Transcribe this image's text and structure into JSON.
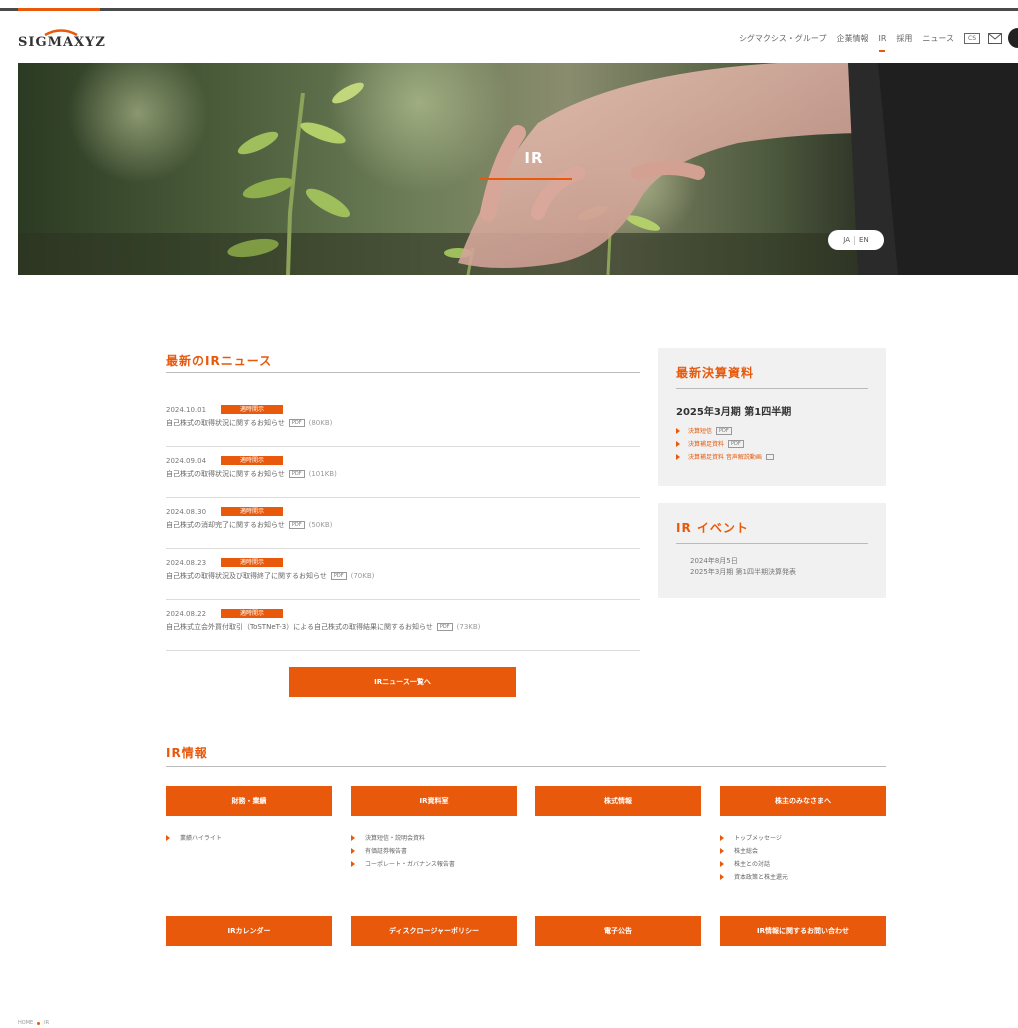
{
  "header": {
    "logo": "SIGMAXYZ",
    "nav": [
      {
        "label": "シグマクシス・グループ"
      },
      {
        "label": "企業情報"
      },
      {
        "label": "IR",
        "active": true
      },
      {
        "label": "採用"
      },
      {
        "label": "ニュース"
      }
    ],
    "box_label": "CS",
    "accent_color": "#e8590c"
  },
  "hero": {
    "title": "IR",
    "lang": [
      "JA",
      "EN"
    ]
  },
  "news": {
    "title": "最新のIRニュース",
    "badge": "適時開示",
    "items": [
      {
        "date": "2024.10.01",
        "text": "自己株式の取得状況に関するお知らせ",
        "size": "(80KB)"
      },
      {
        "date": "2024.09.04",
        "text": "自己株式の取得状況に関するお知らせ",
        "size": "(101KB)"
      },
      {
        "date": "2024.08.30",
        "text": "自己株式の消却完了に関するお知らせ",
        "size": "(50KB)"
      },
      {
        "date": "2024.08.23",
        "text": "自己株式の取得状況及び取得終了に関するお知らせ",
        "size": "(70KB)"
      },
      {
        "date": "2024.08.22",
        "text": "自己株式立会外買付取引（ToSTNeT-3）による自己株式の取得結果に関するお知らせ",
        "size": "(73KB)"
      }
    ],
    "pdf_label": "PDF",
    "more_label": "IRニュース一覧へ"
  },
  "financials": {
    "title": "最新決算資料",
    "period": "2025年3月期 第1四半期",
    "links": [
      {
        "label": "決算短信",
        "tag": "PDF"
      },
      {
        "label": "決算補足資料",
        "tag": "PDF"
      },
      {
        "label": "決算補足資料 音声解説動画",
        "tag": ""
      }
    ]
  },
  "events": {
    "title": "IR イベント",
    "date": "2024年8月5日",
    "text": "2025年3月期 第1四半期決算発表"
  },
  "ir_info": {
    "title": "IR情報",
    "buttons_row1": [
      "財務・業績",
      "IR資料室",
      "株式情報",
      "株主のみなさまへ"
    ],
    "sub_col1": [
      "業績ハイライト"
    ],
    "sub_col2": [
      "決算短信・説明会資料",
      "有価証券報告書",
      "コーポレート・ガバナンス報告書"
    ],
    "sub_col4": [
      "トップメッセージ",
      "株主総会",
      "株主との対話",
      "資本政策と株主還元"
    ],
    "buttons_row2": [
      "IRカレンダー",
      "ディスクロージャーポリシー",
      "電子公告",
      "IR情報に関するお問い合わせ"
    ]
  },
  "breadcrumb": {
    "home": "HOME",
    "current": "IR"
  }
}
